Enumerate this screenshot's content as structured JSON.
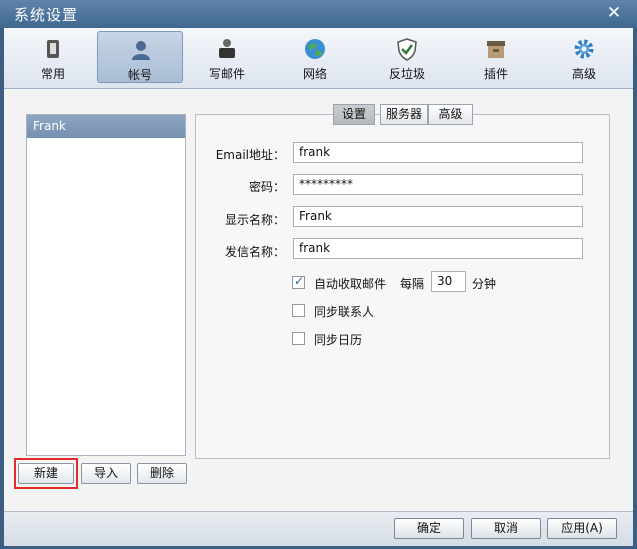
{
  "window": {
    "title": "系统设置"
  },
  "toolbar": {
    "items": [
      {
        "label": "常用",
        "icon": "common-icon"
      },
      {
        "label": "帐号",
        "icon": "account-icon"
      },
      {
        "label": "写邮件",
        "icon": "compose-icon"
      },
      {
        "label": "网络",
        "icon": "network-icon"
      },
      {
        "label": "反垃圾",
        "icon": "antispam-icon"
      },
      {
        "label": "插件",
        "icon": "plugin-icon"
      },
      {
        "label": "高级",
        "icon": "advanced-icon"
      }
    ],
    "active": "帐号"
  },
  "accounts": {
    "items": [
      "Frank"
    ],
    "buttons": {
      "new": "新建",
      "import": "导入",
      "delete": "删除"
    }
  },
  "tabs": {
    "items": [
      "设置",
      "服务器",
      "高级"
    ],
    "active": "设置"
  },
  "form": {
    "email_label": "Email地址：",
    "email_value": "frank",
    "password_label": "密码：",
    "password_value": "*********",
    "display_label": "显示名称：",
    "display_value": "Frank",
    "sender_label": "发信名称：",
    "sender_value": "frank",
    "auto_receive_label": "自动收取邮件",
    "auto_receive_checked": true,
    "interval_prefix": "每隔",
    "interval_value": "30",
    "interval_suffix": "分钟",
    "sync_contacts_label": "同步联系人",
    "sync_contacts_checked": false,
    "sync_calendar_label": "同步日历",
    "sync_calendar_checked": false
  },
  "footer": {
    "ok": "确定",
    "cancel": "取消",
    "apply": "应用(A)"
  },
  "colors": {
    "accent": "#3f6790",
    "highlight": "#e12a2a"
  }
}
